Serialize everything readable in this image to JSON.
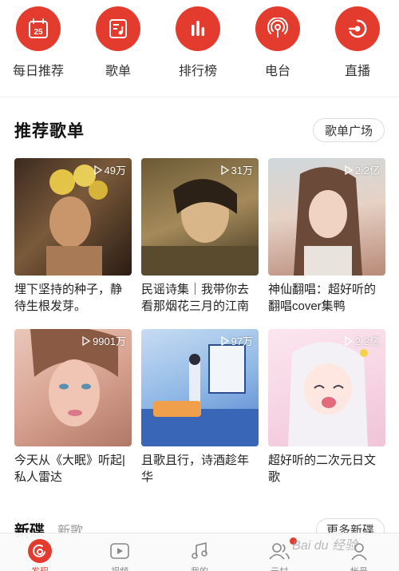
{
  "nav": {
    "items": [
      {
        "label": "每日推荐",
        "icon": "calendar-icon",
        "date": "25"
      },
      {
        "label": "歌单",
        "icon": "playlist-icon"
      },
      {
        "label": "排行榜",
        "icon": "chart-bars-icon"
      },
      {
        "label": "电台",
        "icon": "radio-icon"
      },
      {
        "label": "直播",
        "icon": "live-icon"
      }
    ]
  },
  "recommend": {
    "title": "推荐歌单",
    "more_label": "歌单广场",
    "playlists": [
      {
        "title": "埋下坚持的种子，静待生根发芽。",
        "plays": "49万"
      },
      {
        "title": "民谣诗集｜我带你去看那烟花三月的江南",
        "plays": "31万"
      },
      {
        "title": "神仙翻唱：超好听的翻唱cover集鸭",
        "plays": "2.2亿"
      },
      {
        "title": "今天从《大眠》听起|私人雷达",
        "plays": "9901万"
      },
      {
        "title": "且歌且行，诗酒趁年华",
        "plays": "97万"
      },
      {
        "title": "超好听的二次元日文歌",
        "plays": "2.2亿"
      }
    ]
  },
  "next_section": {
    "title": "新碟",
    "subtitle": "新歌",
    "more_label": "更多新碟"
  },
  "tabbar": {
    "items": [
      {
        "label": "发现",
        "icon": "netease-logo-icon",
        "active": true
      },
      {
        "label": "视频",
        "icon": "video-play-icon"
      },
      {
        "label": "我的",
        "icon": "music-note-icon"
      },
      {
        "label": "云村",
        "icon": "friends-icon",
        "badge": true
      },
      {
        "label": "帐号",
        "icon": "account-icon"
      }
    ]
  },
  "watermark": "Bai du 经验",
  "colors": {
    "accent": "#e33b2d"
  }
}
